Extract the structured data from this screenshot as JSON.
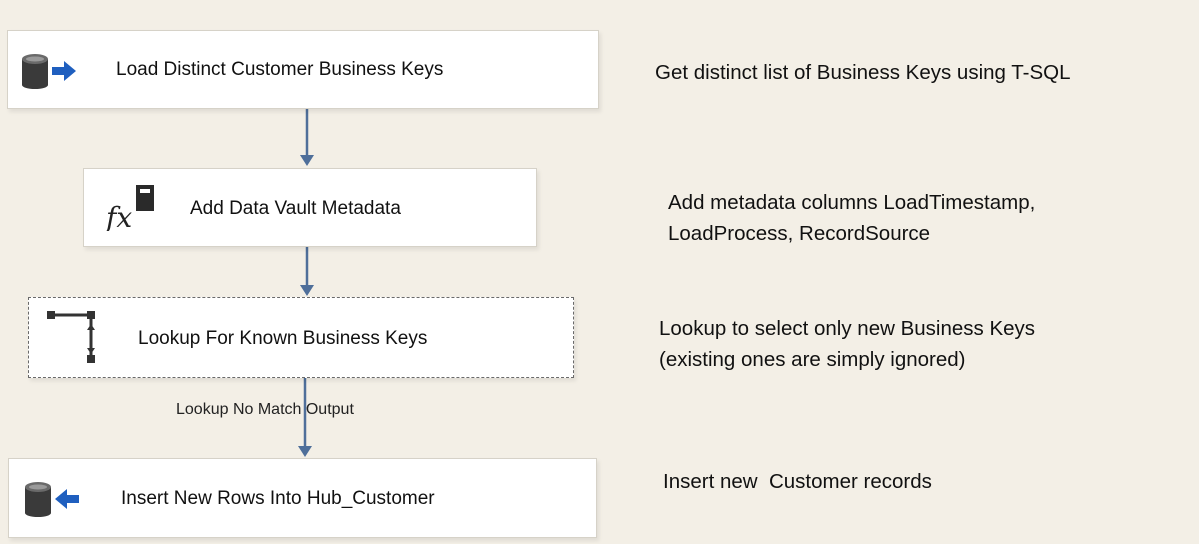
{
  "nodes": [
    {
      "label": "Load Distinct Customer Business Keys",
      "icon": "database-source-icon"
    },
    {
      "label": "Add Data Vault Metadata",
      "icon": "derived-column-fx-icon"
    },
    {
      "label": "Lookup For Known Business Keys",
      "icon": "lookup-icon"
    },
    {
      "label": "Insert New Rows Into Hub_Customer",
      "icon": "database-destination-icon"
    }
  ],
  "notes": [
    {
      "lines": [
        "Get distinct list of Business Keys using T-SQL"
      ]
    },
    {
      "lines": [
        "Add metadata columns LoadTimestamp,",
        "LoadProcess, RecordSource"
      ]
    },
    {
      "lines": [
        "Lookup to select only new Business Keys",
        "(existing ones are simply ignored)"
      ]
    },
    {
      "lines": [
        "Insert new  Customer records"
      ]
    }
  ],
  "connectors": [
    {
      "label": ""
    },
    {
      "label": ""
    },
    {
      "label": "Lookup No Match Output"
    }
  ],
  "colors": {
    "background": "#f3efe6",
    "arrow": "#4f6f9a",
    "icon_dark": "#3a3a3a",
    "icon_blue": "#1f5fbf"
  }
}
